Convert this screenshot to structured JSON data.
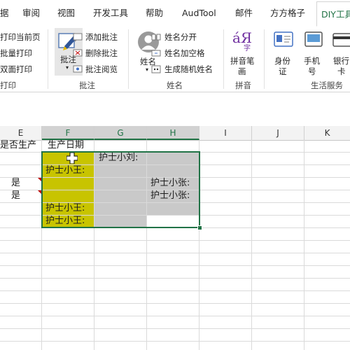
{
  "tabs": [
    {
      "label": "据"
    },
    {
      "label": "审阅"
    },
    {
      "label": "视图"
    },
    {
      "label": "开发工具"
    },
    {
      "label": "帮助"
    },
    {
      "label": "AudTool"
    },
    {
      "label": "邮件"
    },
    {
      "label": "方方格子"
    },
    {
      "label": "DIY工具"
    }
  ],
  "ribbon": {
    "print_group": {
      "items": [
        "打印当前页",
        "批量打印",
        "双面打印"
      ],
      "label": "打印"
    },
    "comment_group": {
      "big_button": "批注",
      "items": [
        "添加批注",
        "删除批注",
        "批注阅览"
      ],
      "label": "批注"
    },
    "name_group": {
      "big_button": "姓名",
      "items": [
        "姓名分开",
        "姓名加空格",
        "生成随机姓名"
      ],
      "label": "姓名"
    },
    "pinyin_group": {
      "big_button_line1": "拼音笔",
      "big_button_line2": "画",
      "label": "拼音"
    },
    "life_group": {
      "buttons": [
        {
          "line1": "身份",
          "line2": "证"
        },
        {
          "line1": "手机",
          "line2": "号"
        },
        {
          "line1": "银行",
          "line2": "卡"
        }
      ],
      "label": "生活服务"
    }
  },
  "sheet": {
    "columns": [
      "E",
      "F",
      "G",
      "H",
      "I",
      "J",
      "K"
    ],
    "selected_columns": [
      "F",
      "G",
      "H"
    ],
    "header_row": {
      "E": "是否生产",
      "F": "生产日期"
    },
    "cells": {
      "G_r1": "护士小刘:",
      "F_r2": "护士小王:",
      "H_r3": "护士小张:",
      "H_r4": "护士小张:",
      "F_r5": "护士小王:",
      "F_r6": "护士小王:",
      "E_r3": "是",
      "E_r4": "是"
    },
    "colors": {
      "selection_border": "#217346",
      "yellow_fill": "#c8c400",
      "gray_fill": "#c9c9c9",
      "comment_indicator": "#c00000"
    }
  }
}
